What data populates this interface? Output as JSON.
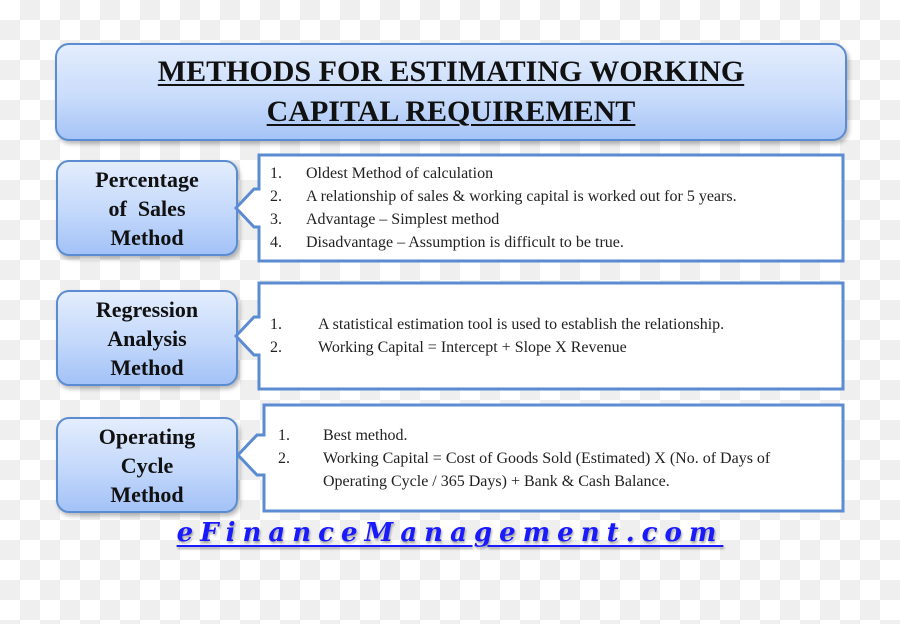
{
  "title": {
    "line1": "METHODS FOR ESTIMATING WORKING",
    "line2": "CAPITAL REQUIREMENT"
  },
  "methods": [
    {
      "name_lines": [
        "Percentage",
        "of  Sales",
        "Method"
      ],
      "items": [
        {
          "num": "1.",
          "text": "Oldest Method of calculation"
        },
        {
          "num": "2.",
          "text": "A relationship of sales & working capital is worked out for 5 years."
        },
        {
          "num": "3.",
          "text": "Advantage – Simplest method"
        },
        {
          "num": "4.",
          "text": "Disadvantage – Assumption is difficult to be true."
        }
      ]
    },
    {
      "name_lines": [
        "Regression",
        "Analysis",
        "Method"
      ],
      "items": [
        {
          "num": "1.",
          "text": "A statistical estimation tool is used to establish the relationship."
        },
        {
          "num": "2.",
          "text": "Working Capital = Intercept + Slope X Revenue"
        }
      ]
    },
    {
      "name_lines": [
        "Operating",
        "Cycle",
        "Method"
      ],
      "items": [
        {
          "num": "1.",
          "text": "Best method."
        },
        {
          "num": "2.",
          "text": "Working Capital = Cost of Goods Sold (Estimated) X (No. of Days of Operating Cycle / 365 Days) + Bank & Cash Balance."
        }
      ]
    }
  ],
  "footer": {
    "site": "eFinanceManagement.com"
  },
  "colors": {
    "box_border": "#5b8bd0",
    "footer_link": "#1a1aff"
  }
}
